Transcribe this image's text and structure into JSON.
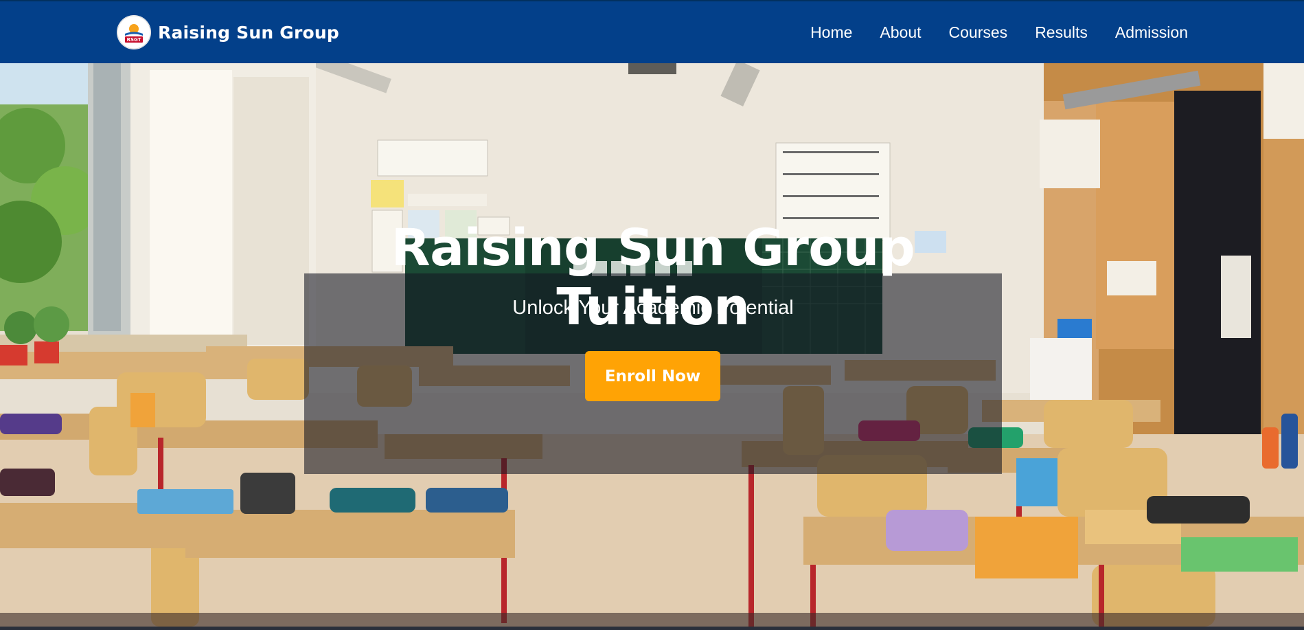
{
  "brand": {
    "logo_text": "RSGT",
    "name": "Raising Sun Group"
  },
  "nav": {
    "items": [
      {
        "label": "Home"
      },
      {
        "label": "About"
      },
      {
        "label": "Courses"
      },
      {
        "label": "Results"
      },
      {
        "label": "Admission"
      }
    ]
  },
  "hero": {
    "title": "Raising Sun Group Tuition",
    "subtitle": "Unlock Your Academic Potential",
    "cta_label": "Enroll Now",
    "background_icon": "classroom-photo"
  },
  "colors": {
    "navbar": "#03408a",
    "cta": "#ffa305",
    "text": "#ffffff"
  }
}
